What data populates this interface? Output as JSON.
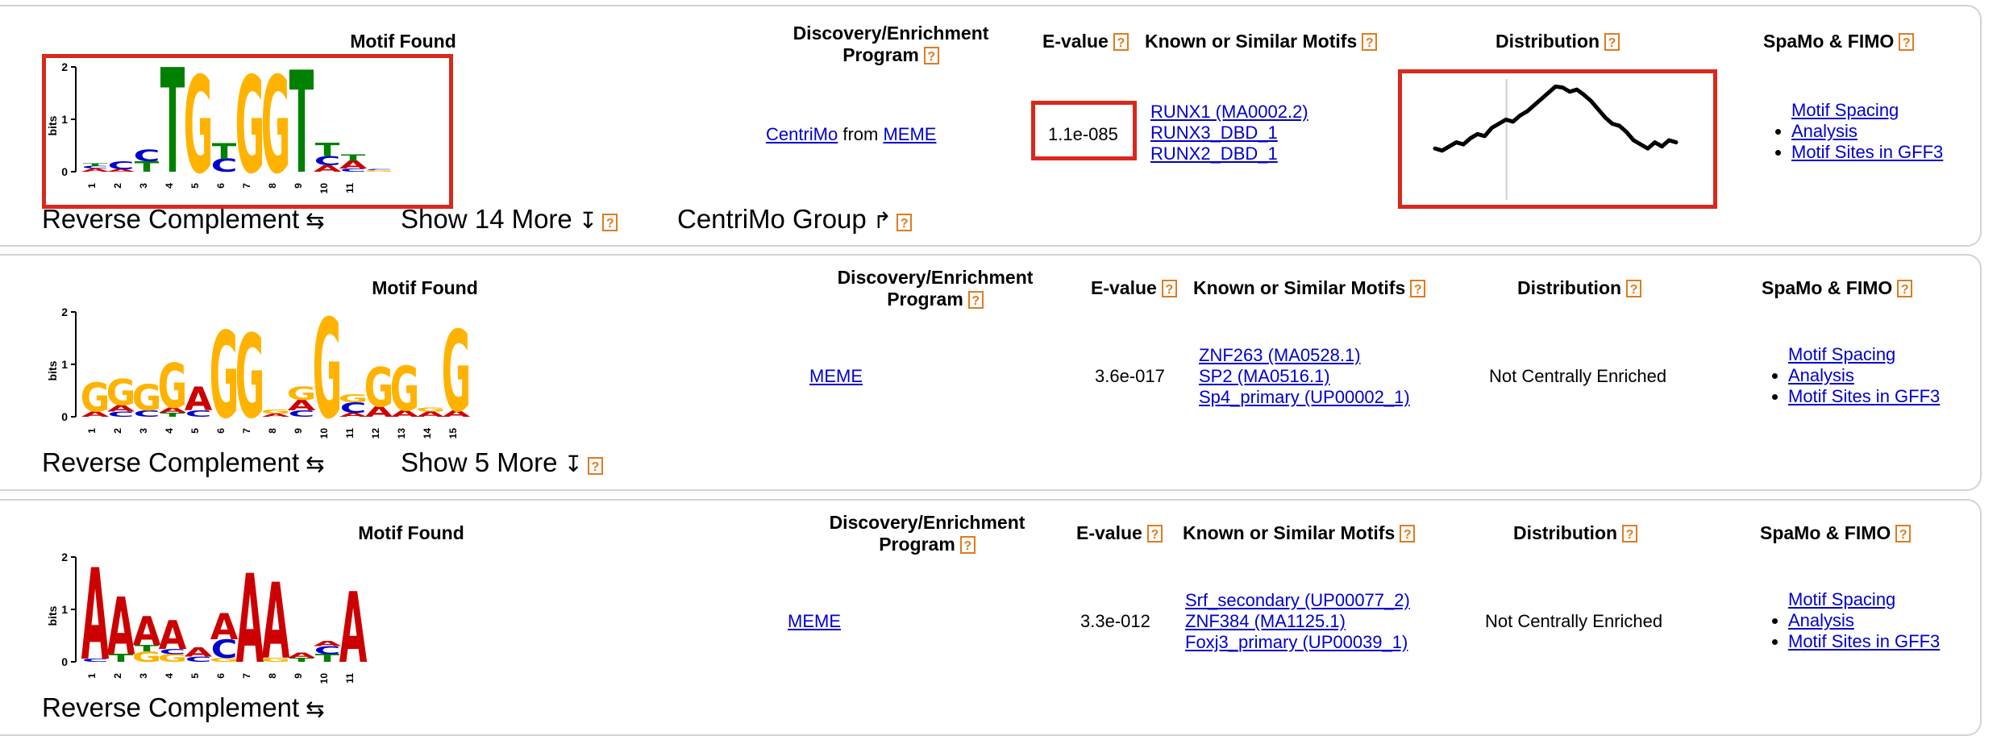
{
  "headers": {
    "motif_found": "Motif Found",
    "program_line1": "Discovery/Enrichment",
    "program_line2": "Program",
    "evalue": "E-value",
    "known_motifs": "Known or Similar Motifs",
    "distribution": "Distribution",
    "spamo_fimo": "SpaMo & FIMO",
    "help_glyph": "?"
  },
  "logo_axis": {
    "bits": "bits",
    "ticks": [
      "0",
      "1",
      "2"
    ]
  },
  "colors": {
    "A": "#cc0000",
    "C": "#0000cc",
    "G": "#ffb300",
    "T": "#008000",
    "border": "#d3d3d3",
    "help": "#e07b1e",
    "highlight": "#d9281c"
  },
  "rows": [
    {
      "program": {
        "link1": "CentriMo",
        "middle": " from ",
        "link2": "MEME"
      },
      "evalue": "1.1e-085",
      "known_motifs": [
        "RUNX1 (MA0002.2)",
        "RUNX3_DBD_1",
        "RUNX2_DBD_1"
      ],
      "distribution": "",
      "spamo_links": [
        "Motif Spacing Analysis",
        "Motif Sites in GFF3"
      ],
      "controls": {
        "reverse": "Reverse Complement",
        "reverse_icon": "⇆",
        "more": "Show 14 More",
        "more_icon": "↧",
        "group": "CentriMo Group",
        "group_icon": "↱"
      },
      "logo_positions": [
        "1",
        "2",
        "3",
        "4",
        "5",
        "6",
        "7",
        "8",
        "9",
        "10",
        "11"
      ],
      "logo_stacks": [
        [
          [
            "A",
            0.06
          ],
          [
            "C",
            0.05
          ],
          [
            "T",
            0.05
          ]
        ],
        [
          [
            "A",
            0.05
          ],
          [
            "C",
            0.15
          ]
        ],
        [
          [
            "T",
            0.2
          ],
          [
            "C",
            0.22
          ]
        ],
        [
          [
            "T",
            2.0
          ]
        ],
        [
          [
            "G",
            1.85
          ]
        ],
        [
          [
            "C",
            0.25
          ],
          [
            "T",
            0.3
          ]
        ],
        [
          [
            "G",
            1.85
          ]
        ],
        [
          [
            "G",
            1.85
          ]
        ],
        [
          [
            "T",
            1.95
          ]
        ],
        [
          [
            "A",
            0.12
          ],
          [
            "C",
            0.18
          ],
          [
            "T",
            0.25
          ]
        ],
        [
          [
            "C",
            0.06
          ],
          [
            "A",
            0.15
          ],
          [
            "T",
            0.12
          ]
        ],
        [
          [
            "G",
            0.03
          ],
          [
            "C",
            0.02
          ]
        ]
      ]
    },
    {
      "program": {
        "link1": "MEME"
      },
      "evalue": "3.6e-017",
      "known_motifs": [
        "ZNF263 (MA0528.1)",
        "SP2 (MA0516.1)",
        "Sp4_primary (UP00002_1)"
      ],
      "distribution": "Not Centrally Enriched",
      "spamo_links": [
        "Motif Spacing Analysis",
        "Motif Sites in GFF3"
      ],
      "controls": {
        "reverse": "Reverse Complement",
        "reverse_icon": "⇆",
        "more": "Show 5 More",
        "more_icon": "↧"
      },
      "logo_positions": [
        "1",
        "2",
        "3",
        "4",
        "5",
        "6",
        "7",
        "8",
        "9",
        "10",
        "11",
        "12",
        "13",
        "14",
        "15"
      ],
      "logo_stacks": [
        [
          [
            "A",
            0.1
          ],
          [
            "G",
            0.55
          ]
        ],
        [
          [
            "C",
            0.1
          ],
          [
            "A",
            0.12
          ],
          [
            "G",
            0.5
          ]
        ],
        [
          [
            "C",
            0.12
          ],
          [
            "G",
            0.5
          ]
        ],
        [
          [
            "T",
            0.08
          ],
          [
            "A",
            0.1
          ],
          [
            "G",
            0.85
          ]
        ],
        [
          [
            "C",
            0.12
          ],
          [
            "A",
            0.45
          ]
        ],
        [
          [
            "G",
            1.65
          ]
        ],
        [
          [
            "G",
            1.6
          ]
        ],
        [
          [
            "A",
            0.06
          ],
          [
            "G",
            0.08
          ]
        ],
        [
          [
            "C",
            0.12
          ],
          [
            "A",
            0.2
          ],
          [
            "G",
            0.25
          ]
        ],
        [
          [
            "G",
            1.9
          ]
        ],
        [
          [
            "A",
            0.08
          ],
          [
            "C",
            0.2
          ],
          [
            "G",
            0.15
          ]
        ],
        [
          [
            "A",
            0.2
          ],
          [
            "G",
            0.75
          ]
        ],
        [
          [
            "A",
            0.12
          ],
          [
            "G",
            0.85
          ]
        ],
        [
          [
            "A",
            0.1
          ],
          [
            "G",
            0.08
          ]
        ],
        [
          [
            "A",
            0.12
          ],
          [
            "G",
            1.55
          ]
        ]
      ]
    },
    {
      "program": {
        "link1": "MEME"
      },
      "evalue": "3.3e-012",
      "known_motifs": [
        "Srf_secondary (UP00077_2)",
        "ZNF384 (MA1125.1)",
        "Foxj3_primary (UP00039_1)"
      ],
      "distribution": "Not Centrally Enriched",
      "spamo_links": [
        "Motif Spacing Analysis",
        "Motif Sites in GFF3"
      ],
      "controls": {
        "reverse": "Reverse Complement",
        "reverse_icon": "⇆"
      },
      "logo_positions": [
        "1",
        "2",
        "3",
        "4",
        "5",
        "6",
        "7",
        "8",
        "9",
        "10",
        "11"
      ],
      "logo_stacks": [
        [
          [
            "C",
            0.06
          ],
          [
            "A",
            1.75
          ]
        ],
        [
          [
            "T",
            0.15
          ],
          [
            "A",
            1.1
          ]
        ],
        [
          [
            "G",
            0.2
          ],
          [
            "T",
            0.12
          ],
          [
            "A",
            0.55
          ]
        ],
        [
          [
            "G",
            0.15
          ],
          [
            "C",
            0.1
          ],
          [
            "A",
            0.55
          ]
        ],
        [
          [
            "C",
            0.1
          ],
          [
            "A",
            0.18
          ]
        ],
        [
          [
            "G",
            0.08
          ],
          [
            "C",
            0.35
          ],
          [
            "A",
            0.5
          ]
        ],
        [
          [
            "A",
            1.7
          ]
        ],
        [
          [
            "G",
            0.08
          ],
          [
            "A",
            1.45
          ]
        ],
        [
          [
            "T",
            0.08
          ],
          [
            "A",
            0.1
          ]
        ],
        [
          [
            "T",
            0.15
          ],
          [
            "C",
            0.15
          ],
          [
            "A",
            0.1
          ]
        ],
        [
          [
            "A",
            1.35
          ]
        ]
      ]
    }
  ],
  "distribution_curve": {
    "values": [
      0.38,
      0.36,
      0.4,
      0.44,
      0.42,
      0.48,
      0.52,
      0.5,
      0.58,
      0.62,
      0.66,
      0.64,
      0.7,
      0.74,
      0.8,
      0.86,
      0.92,
      0.98,
      0.97,
      0.93,
      0.95,
      0.9,
      0.84,
      0.76,
      0.68,
      0.62,
      0.6,
      0.54,
      0.46,
      0.42,
      0.38,
      0.44,
      0.4,
      0.46,
      0.44
    ]
  }
}
